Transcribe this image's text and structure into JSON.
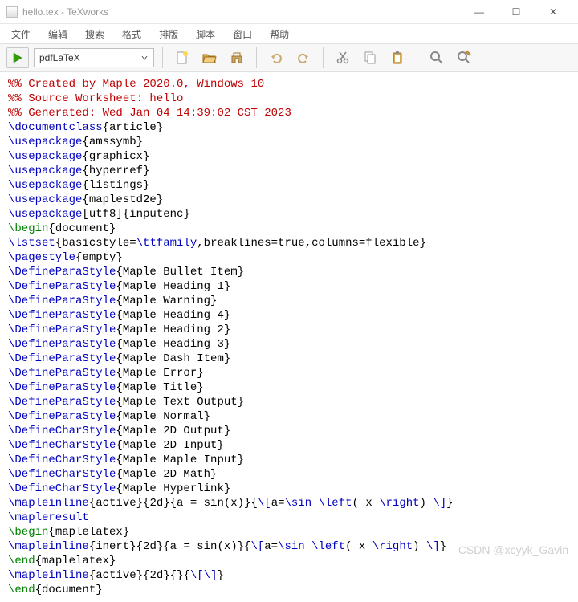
{
  "titlebar": {
    "title": "hello.tex - TeXworks",
    "min": "—",
    "max": "☐",
    "close": "✕"
  },
  "menubar": {
    "file": "文件",
    "edit": "编辑",
    "search": "搜索",
    "format": "格式",
    "typeset": "排版",
    "script": "脚本",
    "window": "窗口",
    "help": "帮助"
  },
  "toolbar": {
    "compiler": "pdfLaTeX"
  },
  "watermark": "CSDN @xcyyk_Gavin",
  "code": {
    "lines": [
      [
        [
          "red",
          "%% Created by Maple 2020.0, Windows 10"
        ]
      ],
      [
        [
          "red",
          "%% Source Worksheet: hello"
        ]
      ],
      [
        [
          "red",
          "%% Generated: Wed Jan 04 14:39:02 CST 2023"
        ]
      ],
      [
        [
          "blue",
          "\\documentclass"
        ],
        [
          "black",
          "{article}"
        ]
      ],
      [
        [
          "blue",
          "\\usepackage"
        ],
        [
          "black",
          "{amssymb}"
        ]
      ],
      [
        [
          "blue",
          "\\usepackage"
        ],
        [
          "black",
          "{graphicx}"
        ]
      ],
      [
        [
          "blue",
          "\\usepackage"
        ],
        [
          "black",
          "{hyperref}"
        ]
      ],
      [
        [
          "blue",
          "\\usepackage"
        ],
        [
          "black",
          "{listings}"
        ]
      ],
      [
        [
          "blue",
          "\\usepackage"
        ],
        [
          "black",
          "{maplestd2e}"
        ]
      ],
      [
        [
          "blue",
          "\\usepackage"
        ],
        [
          "black",
          "[utf8]{inputenc}"
        ]
      ],
      [
        [
          "green",
          "\\begin"
        ],
        [
          "black",
          "{document}"
        ]
      ],
      [
        [
          "blue",
          "\\lstset"
        ],
        [
          "black",
          "{basicstyle="
        ],
        [
          "blue",
          "\\ttfamily"
        ],
        [
          "black",
          ",breaklines=true,columns=flexible}"
        ]
      ],
      [
        [
          "blue",
          "\\pagestyle"
        ],
        [
          "black",
          "{empty}"
        ]
      ],
      [
        [
          "blue",
          "\\DefineParaStyle"
        ],
        [
          "black",
          "{Maple Bullet Item}"
        ]
      ],
      [
        [
          "blue",
          "\\DefineParaStyle"
        ],
        [
          "black",
          "{Maple Heading 1}"
        ]
      ],
      [
        [
          "blue",
          "\\DefineParaStyle"
        ],
        [
          "black",
          "{Maple Warning}"
        ]
      ],
      [
        [
          "blue",
          "\\DefineParaStyle"
        ],
        [
          "black",
          "{Maple Heading 4}"
        ]
      ],
      [
        [
          "blue",
          "\\DefineParaStyle"
        ],
        [
          "black",
          "{Maple Heading 2}"
        ]
      ],
      [
        [
          "blue",
          "\\DefineParaStyle"
        ],
        [
          "black",
          "{Maple Heading 3}"
        ]
      ],
      [
        [
          "blue",
          "\\DefineParaStyle"
        ],
        [
          "black",
          "{Maple Dash Item}"
        ]
      ],
      [
        [
          "blue",
          "\\DefineParaStyle"
        ],
        [
          "black",
          "{Maple Error}"
        ]
      ],
      [
        [
          "blue",
          "\\DefineParaStyle"
        ],
        [
          "black",
          "{Maple Title}"
        ]
      ],
      [
        [
          "blue",
          "\\DefineParaStyle"
        ],
        [
          "black",
          "{Maple Text Output}"
        ]
      ],
      [
        [
          "blue",
          "\\DefineParaStyle"
        ],
        [
          "black",
          "{Maple Normal}"
        ]
      ],
      [
        [
          "blue",
          "\\DefineCharStyle"
        ],
        [
          "black",
          "{Maple 2D Output}"
        ]
      ],
      [
        [
          "blue",
          "\\DefineCharStyle"
        ],
        [
          "black",
          "{Maple 2D Input}"
        ]
      ],
      [
        [
          "blue",
          "\\DefineCharStyle"
        ],
        [
          "black",
          "{Maple Maple Input}"
        ]
      ],
      [
        [
          "blue",
          "\\DefineCharStyle"
        ],
        [
          "black",
          "{Maple 2D Math}"
        ]
      ],
      [
        [
          "blue",
          "\\DefineCharStyle"
        ],
        [
          "black",
          "{Maple Hyperlink}"
        ]
      ],
      [
        [
          "blue",
          "\\mapleinline"
        ],
        [
          "black",
          "{active}{2d}{a = sin(x)}{"
        ],
        [
          "blue",
          "\\["
        ],
        [
          "black",
          "a="
        ],
        [
          "blue",
          "\\sin \\left"
        ],
        [
          "black",
          "( x "
        ],
        [
          "blue",
          "\\right"
        ],
        [
          "black",
          ") "
        ],
        [
          "blue",
          "\\]"
        ],
        [
          "black",
          "}"
        ]
      ],
      [
        [
          "blue",
          "\\mapleresult"
        ]
      ],
      [
        [
          "green",
          "\\begin"
        ],
        [
          "black",
          "{maplelatex}"
        ]
      ],
      [
        [
          "blue",
          "\\mapleinline"
        ],
        [
          "black",
          "{inert}{2d}{a = sin(x)}{"
        ],
        [
          "blue",
          "\\["
        ],
        [
          "black",
          "a="
        ],
        [
          "blue",
          "\\sin \\left"
        ],
        [
          "black",
          "( x "
        ],
        [
          "blue",
          "\\right"
        ],
        [
          "black",
          ") "
        ],
        [
          "blue",
          "\\]"
        ],
        [
          "black",
          "}"
        ]
      ],
      [
        [
          "green",
          "\\end"
        ],
        [
          "black",
          "{maplelatex}"
        ]
      ],
      [
        [
          "blue",
          "\\mapleinline"
        ],
        [
          "black",
          "{active}{2d}{}{"
        ],
        [
          "blue",
          "\\[\\]"
        ],
        [
          "black",
          "}"
        ]
      ],
      [
        [
          "green",
          "\\end"
        ],
        [
          "black",
          "{document}"
        ]
      ]
    ]
  }
}
